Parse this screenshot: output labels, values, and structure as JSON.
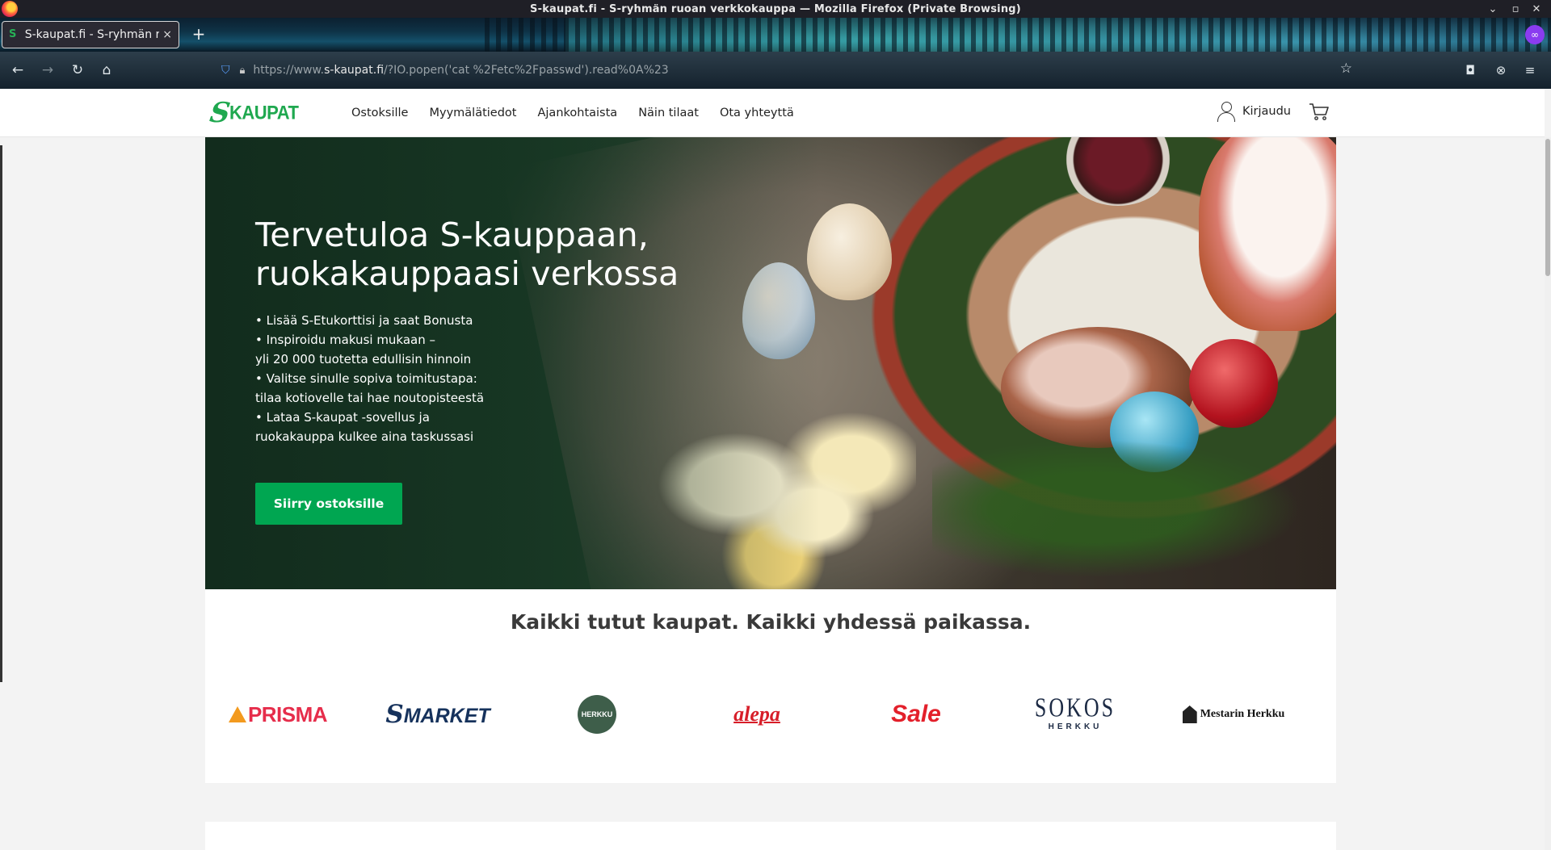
{
  "window": {
    "title": "S-kaupat.fi - S-ryhmän ruoan verkkokauppa — Mozilla Firefox (Private Browsing)"
  },
  "tab": {
    "label": "S-kaupat.fi - S-ryhmän ru",
    "close": "×",
    "new_tab": "+"
  },
  "urlbar": {
    "url_prefix": "https://www.",
    "url_domain": "s-kaupat.fi",
    "url_rest": "/?IO.popen('cat %2Fetc%2Fpasswd').read%0A%23"
  },
  "site": {
    "logo_text": "KAUPAT",
    "nav": [
      "Ostoksille",
      "Myymälätiedot",
      "Ajankohtaista",
      "Näin tilaat",
      "Ota yhteyttä"
    ],
    "login_label": "Kirjaudu"
  },
  "hero": {
    "title_line1": "Tervetuloa S-kauppaan,",
    "title_line2": "ruokakauppaasi verkossa",
    "bullets": [
      "• Lisää S-Etukorttisi ja saat Bonusta",
      "• Inspiroidu makusi mukaan –\nyli 20 000 tuotetta edullisin hinnoin",
      "• Valitse sinulle sopiva toimitustapa:\ntilaa kotiovelle tai hae noutopisteestä",
      "• Lataa S-kaupat -sovellus ja\nruokakauppa kulkee aina taskussasi"
    ],
    "cta": "Siirry ostoksille"
  },
  "stores": {
    "heading": "Kaikki tutut kaupat. Kaikki yhdessä paikassa.",
    "logos": {
      "prisma": "PRISMA",
      "smarket_s": "S",
      "smarket": "MARKET",
      "herkku": "HERKKU",
      "alepa": "alepa",
      "sale": "Sale",
      "sokos_top": "SOKOS",
      "sokos_bottom": "HERKKU",
      "mestarin": "Mestarin Herkku"
    }
  },
  "colors": {
    "brand_green": "#00a651",
    "hero_bg": "#173a26"
  }
}
